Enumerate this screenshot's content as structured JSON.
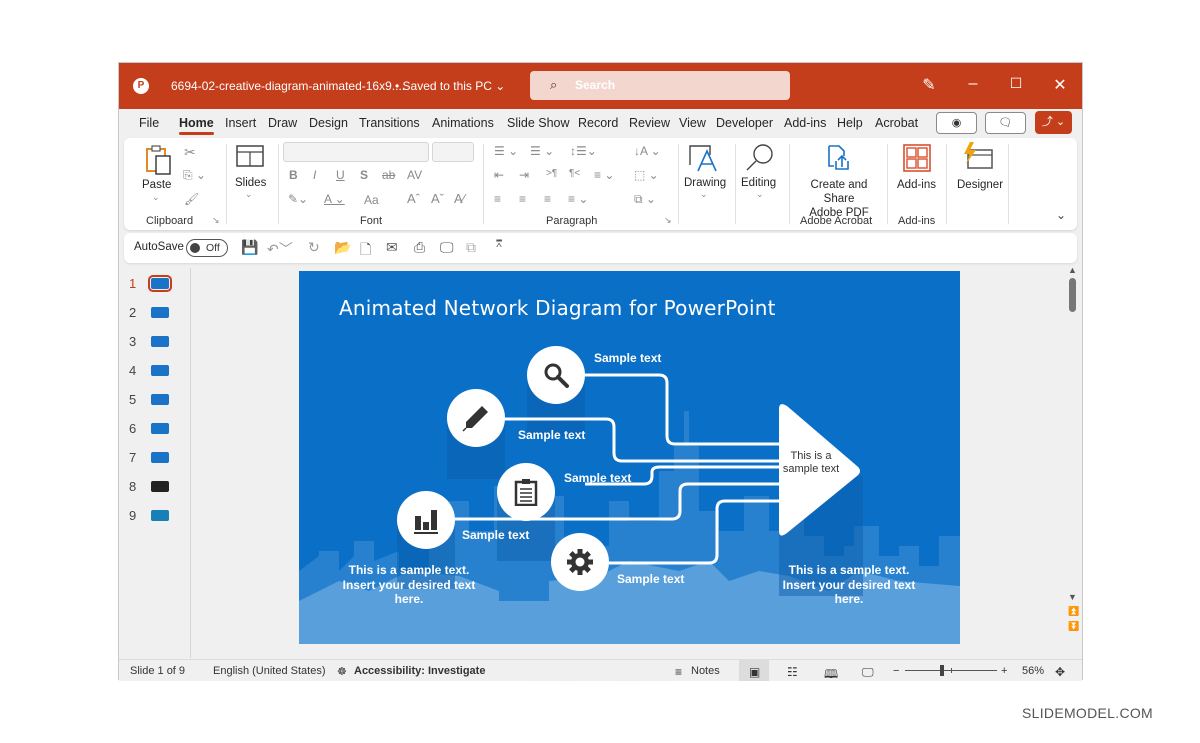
{
  "window": {
    "app_icon": "powerpoint-icon",
    "filename": "6694-02-creative-diagram-animated-16x9....",
    "save_status": "• Saved to this PC ⌄",
    "search_placeholder": "Search",
    "accent_color": "#c43e1c"
  },
  "tabs": [
    {
      "label": "File"
    },
    {
      "label": "Home",
      "active": true
    },
    {
      "label": "Insert"
    },
    {
      "label": "Draw"
    },
    {
      "label": "Design"
    },
    {
      "label": "Transitions"
    },
    {
      "label": "Animations"
    },
    {
      "label": "Slide Show"
    },
    {
      "label": "Record"
    },
    {
      "label": "Review"
    },
    {
      "label": "View"
    },
    {
      "label": "Developer"
    },
    {
      "label": "Add-ins"
    },
    {
      "label": "Help"
    },
    {
      "label": "Acrobat"
    }
  ],
  "ribbon": {
    "paste": "Paste",
    "clipboard": "Clipboard",
    "slides": "Slides",
    "font": "Font",
    "paragraph": "Paragraph",
    "drawing": "Drawing",
    "editing": "Editing",
    "create_share_1": "Create and Share",
    "create_share_2": "Adobe PDF",
    "adobe_acrobat": "Adobe Acrobat",
    "addins_btn": "Add-ins",
    "addins_group": "Add-ins",
    "designer": "Designer",
    "font_buttons": [
      "B",
      "I",
      "U",
      "S",
      "ab",
      "AV"
    ],
    "aa": "Aa"
  },
  "qat": {
    "autosave": "AutoSave",
    "toggle_state": "Off"
  },
  "thumbnails": [
    {
      "num": "1",
      "active": true,
      "color": "#1a73c7"
    },
    {
      "num": "2",
      "color": "#1a73c7"
    },
    {
      "num": "3",
      "color": "#1a73c7"
    },
    {
      "num": "4",
      "color": "#1a73c7"
    },
    {
      "num": "5",
      "color": "#1a73c7"
    },
    {
      "num": "6",
      "color": "#1a73c7"
    },
    {
      "num": "7",
      "color": "#1a73c7"
    },
    {
      "num": "8",
      "color": "#222222"
    },
    {
      "num": "9",
      "color": "#1a7fb8"
    }
  ],
  "slide": {
    "title": "Animated Network Diagram for PowerPoint",
    "bg_color": "#0a6fc6",
    "nodes": [
      {
        "icon": "search",
        "label": "Sample text"
      },
      {
        "icon": "pencil",
        "label": "Sample text"
      },
      {
        "icon": "clipboard",
        "label": "Sample text"
      },
      {
        "icon": "bar-chart",
        "label": "Sample text"
      },
      {
        "icon": "gear",
        "label": "Sample text"
      }
    ],
    "triangle_text": "This is a sample text",
    "left_paragraph": "This is a sample text. Insert your desired text here.",
    "right_paragraph": "This is a sample text. Insert your desired text here."
  },
  "status": {
    "slide_of": "Slide 1 of 9",
    "language": "English (United States)",
    "accessibility": "Accessibility: Investigate",
    "notes": "Notes",
    "zoom": "56%",
    "zoom_fraction": 0.4
  },
  "watermark": "SLIDEMODEL.COM"
}
